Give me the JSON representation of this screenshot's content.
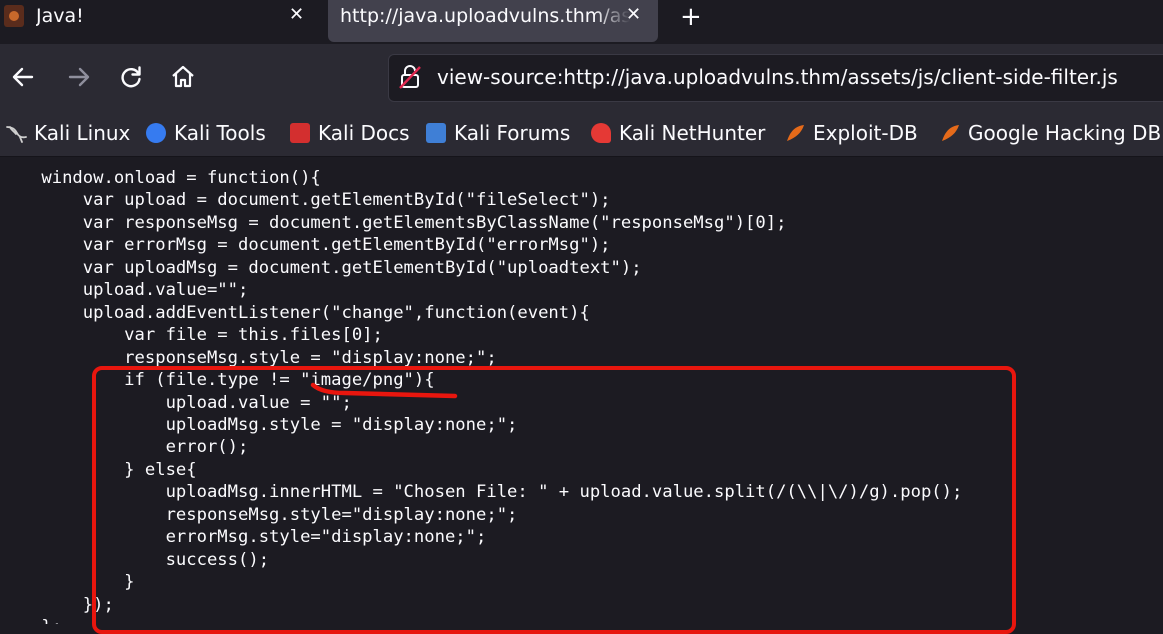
{
  "tabs": [
    {
      "title": "Java!",
      "active": false
    },
    {
      "title": "http://java.uploadvulns.thm/assets/js/client-side-filter.js",
      "active": true
    }
  ],
  "nav": {
    "url": "view-source:http://java.uploadvulns.thm/assets/js/client-side-filter.js"
  },
  "bookmarks": [
    {
      "label": "Kali Linux",
      "icon": "kali-dragon-icon",
      "color": "#cfcfcf"
    },
    {
      "label": "Kali Tools",
      "icon": "kali-tools-icon",
      "color": "#367bf0"
    },
    {
      "label": "Kali Docs",
      "icon": "kali-docs-icon",
      "color": "#d32f2f"
    },
    {
      "label": "Kali Forums",
      "icon": "kali-forums-icon",
      "color": "#3f7fd6"
    },
    {
      "label": "Kali NetHunter",
      "icon": "kali-nethunter-icon",
      "color": "#e53935"
    },
    {
      "label": "Exploit-DB",
      "icon": "exploit-db-icon",
      "color": "#e56a1a"
    },
    {
      "label": "Google Hacking DB",
      "icon": "google-hacking-db-icon",
      "color": "#e56a1a"
    }
  ],
  "source_lines": [
    "    window.onload = function(){",
    "        var upload = document.getElementById(\"fileSelect\");",
    "        var responseMsg = document.getElementsByClassName(\"responseMsg\")[0];",
    "        var errorMsg = document.getElementById(\"errorMsg\");",
    "        var uploadMsg = document.getElementById(\"uploadtext\");",
    "        upload.value=\"\";",
    "        upload.addEventListener(\"change\",function(event){",
    "            var file = this.files[0];",
    "            responseMsg.style = \"display:none;\";",
    "            if (file.type != \"image/png\"){",
    "                upload.value = \"\";",
    "                uploadMsg.style = \"display:none;\";",
    "                error();",
    "            } else{",
    "                uploadMsg.innerHTML = \"Chosen File: \" + upload.value.split(/(\\\\|\\/)/g).pop();",
    "                responseMsg.style=\"display:none;\";",
    "                errorMsg.style=\"display:none;\";",
    "                success();",
    "            }",
    "        });",
    "    };"
  ],
  "annotation_color": "#e8160e"
}
